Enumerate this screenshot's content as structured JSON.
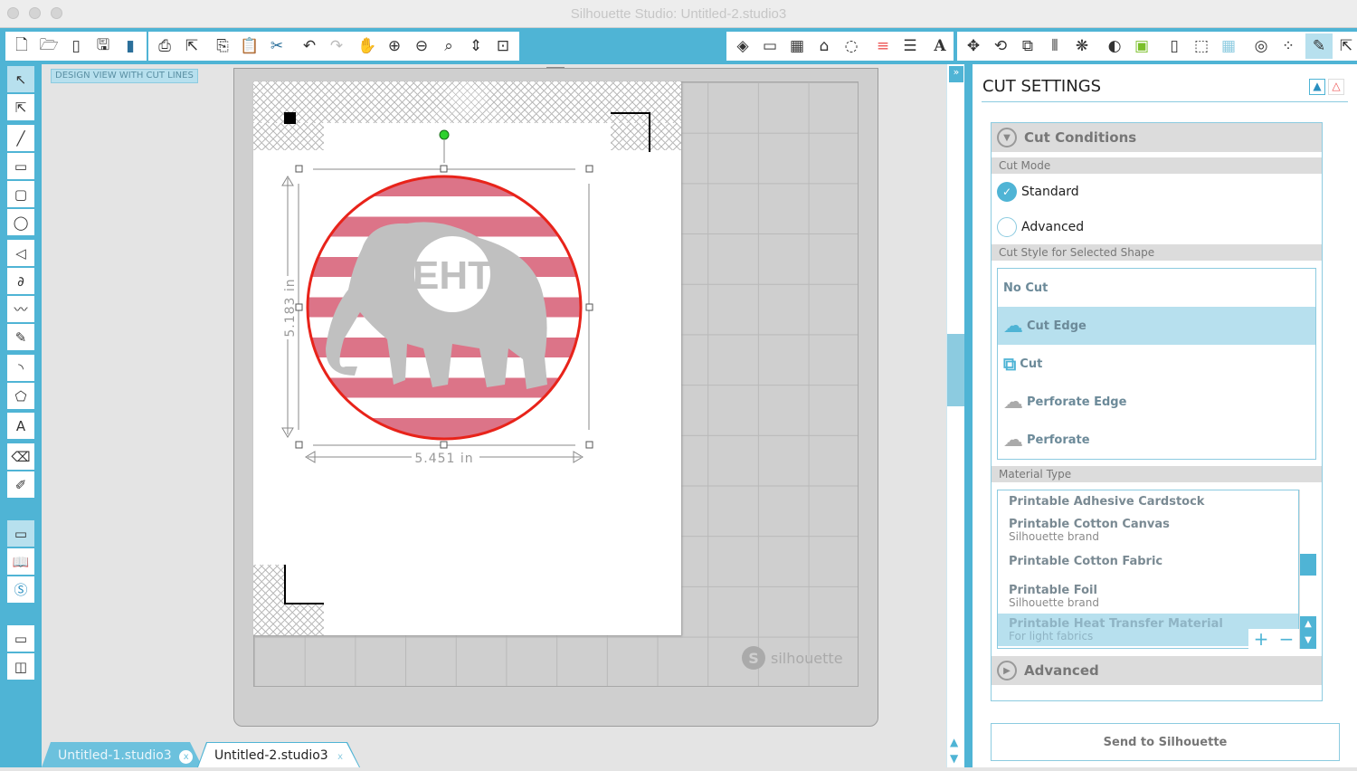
{
  "window": {
    "title": "Silhouette Studio: Untitled-2.studio3"
  },
  "toolbar": {
    "groups": [
      [
        "new-document",
        "open",
        "open-library",
        "save",
        "save-to-library"
      ],
      [
        "print",
        "send"
      ],
      [
        "copy",
        "paste",
        "cut"
      ],
      [
        "undo",
        "redo"
      ],
      [
        "pan",
        "zoom-in",
        "zoom-out",
        "zoom-select",
        "drag-zoom",
        "fit-to-page"
      ],
      [
        "fill",
        "page-setup",
        "grid",
        "library",
        "point"
      ],
      [
        "line-style",
        "line-width"
      ],
      [
        "text-style"
      ],
      [
        "transform",
        "rotate",
        "scale",
        "align",
        "replicate"
      ],
      [
        "trace",
        "store"
      ],
      [
        "design-page",
        "cut-settings",
        "grid-settings"
      ],
      [
        "offset",
        "modify"
      ],
      [
        "cut-settings-panel",
        "send-to-silhouette"
      ]
    ]
  },
  "left_tools": [
    "select",
    "edit-points",
    "line",
    "rectangle",
    "rounded-rectangle",
    "ellipse",
    "polygon-draw",
    "curve",
    "freehand",
    "smooth-freehand",
    "arc",
    "regular-polygon",
    "text",
    "eraser",
    "knife",
    "design-view",
    "library-view",
    "silhouette-store",
    "layout-view",
    "split-view"
  ],
  "canvas": {
    "view_label": "DESIGN VIEW WITH CUT LINES",
    "height_label": "5.183 in",
    "width_label": "5.451 in",
    "monogram": "EHT",
    "brand_watermark": "silhouette",
    "stripe_color": "#dc7488",
    "cut_line_color": "#e8231a",
    "elephant_color": "#c0c0c0"
  },
  "panel": {
    "title": "CUT SETTINGS",
    "cut_conditions": "Cut Conditions",
    "cut_mode_label": "Cut Mode",
    "cut_modes": [
      {
        "label": "Standard",
        "selected": true
      },
      {
        "label": "Advanced",
        "selected": false
      }
    ],
    "cut_style_label": "Cut Style for Selected Shape",
    "cut_styles": [
      {
        "label": "No Cut",
        "selected": false
      },
      {
        "label": "Cut Edge",
        "selected": true
      },
      {
        "label": "Cut",
        "selected": false
      },
      {
        "label": "Perforate Edge",
        "selected": false
      },
      {
        "label": "Perforate",
        "selected": false
      }
    ],
    "material_type_label": "Material Type",
    "materials": [
      {
        "name": "Printable Adhesive Cardstock",
        "sub": ""
      },
      {
        "name": "Printable Cotton Canvas",
        "sub": "Silhouette brand"
      },
      {
        "name": "Printable Cotton Fabric",
        "sub": ""
      },
      {
        "name": "Printable Foil",
        "sub": "Silhouette brand"
      },
      {
        "name": "Printable Heat Transfer Material",
        "sub": "For light fabrics",
        "selected": true
      }
    ],
    "add": "+",
    "remove": "−",
    "advanced": "Advanced",
    "send_button": "Send to Silhouette"
  },
  "tabs": [
    {
      "label": "Untitled-1.studio3",
      "active": false
    },
    {
      "label": "Untitled-2.studio3",
      "active": true
    }
  ],
  "accent": "#4fb4d5"
}
